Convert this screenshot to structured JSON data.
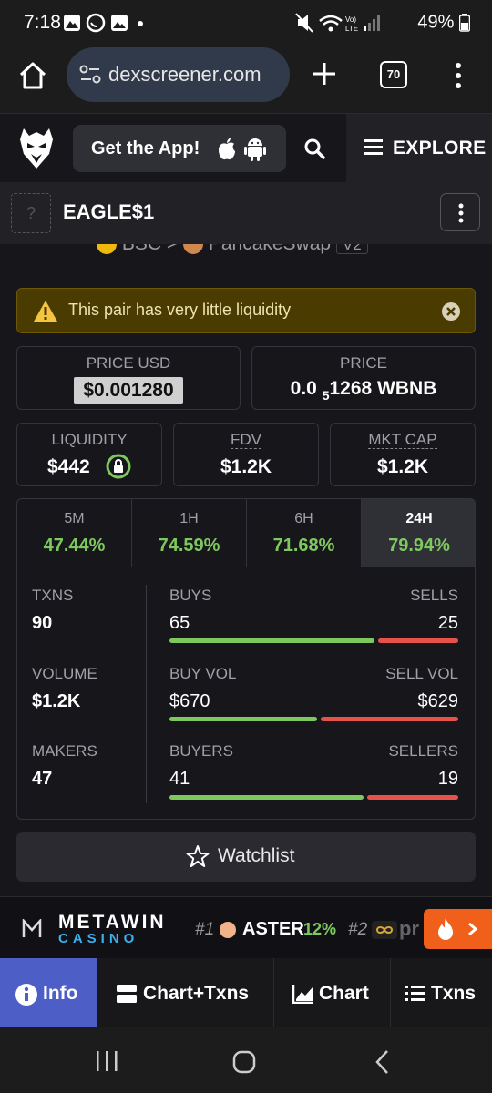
{
  "status_bar": {
    "time": "7:18",
    "battery": "49%"
  },
  "browser": {
    "url": "dexscreener.com",
    "tab_count": "70"
  },
  "header": {
    "get_app_label": "Get the App!",
    "explore_label": "EXPLORE"
  },
  "pair": {
    "name": "EAGLE$1",
    "chain": "BSC",
    "dex": "PancakeSwap",
    "version": "V2",
    "placeholder_icon": "?"
  },
  "warning": {
    "text": "This pair has very little liquidity"
  },
  "price": {
    "usd_label": "PRICE USD",
    "usd_value": "$0.001280",
    "native_label": "PRICE",
    "native_prefix": "0.0",
    "native_subscript": "5",
    "native_rest": "1268 WBNB"
  },
  "metrics": {
    "liquidity_label": "LIQUIDITY",
    "liquidity_value": "$442",
    "fdv_label": "FDV",
    "fdv_value": "$1.2K",
    "mktcap_label": "MKT CAP",
    "mktcap_value": "$1.2K"
  },
  "timeframes": [
    {
      "label": "5M",
      "value": "47.44%"
    },
    {
      "label": "1H",
      "value": "74.59%"
    },
    {
      "label": "6H",
      "value": "71.68%"
    },
    {
      "label": "24H",
      "value": "79.94%",
      "active": true
    }
  ],
  "stats": {
    "txns_label": "TXNS",
    "txns_value": "90",
    "volume_label": "VOLUME",
    "volume_value": "$1.2K",
    "makers_label": "MAKERS",
    "makers_value": "47",
    "buys_label": "BUYS",
    "buys_value": "65",
    "sells_label": "SELLS",
    "sells_value": "25",
    "buyvol_label": "BUY VOL",
    "buyvol_value": "$670",
    "sellvol_label": "SELL VOL",
    "sellvol_value": "$629",
    "buyers_label": "BUYERS",
    "buyers_value": "41",
    "sellers_label": "SELLERS",
    "sellers_value": "19",
    "buy_fraction_txns": 0.72,
    "buy_fraction_volume": 0.516,
    "buy_fraction_makers": 0.68
  },
  "watchlist": {
    "label": "Watchlist"
  },
  "ad": {
    "brand_top": "METAWIN",
    "brand_bottom": "CASINO",
    "rank1": "#1",
    "rank1_token": "ASTER",
    "rank1_change": "12%",
    "rank2": "#2",
    "rank2_token": "pr"
  },
  "bottom_nav": {
    "info": "Info",
    "chart_txns": "Chart+Txns",
    "chart": "Chart",
    "txns": "Txns"
  },
  "colors": {
    "green": "#7dc95e",
    "red": "#e5534b",
    "accent_blue": "#4e5ec7",
    "warning_bg": "#4a3b00"
  }
}
